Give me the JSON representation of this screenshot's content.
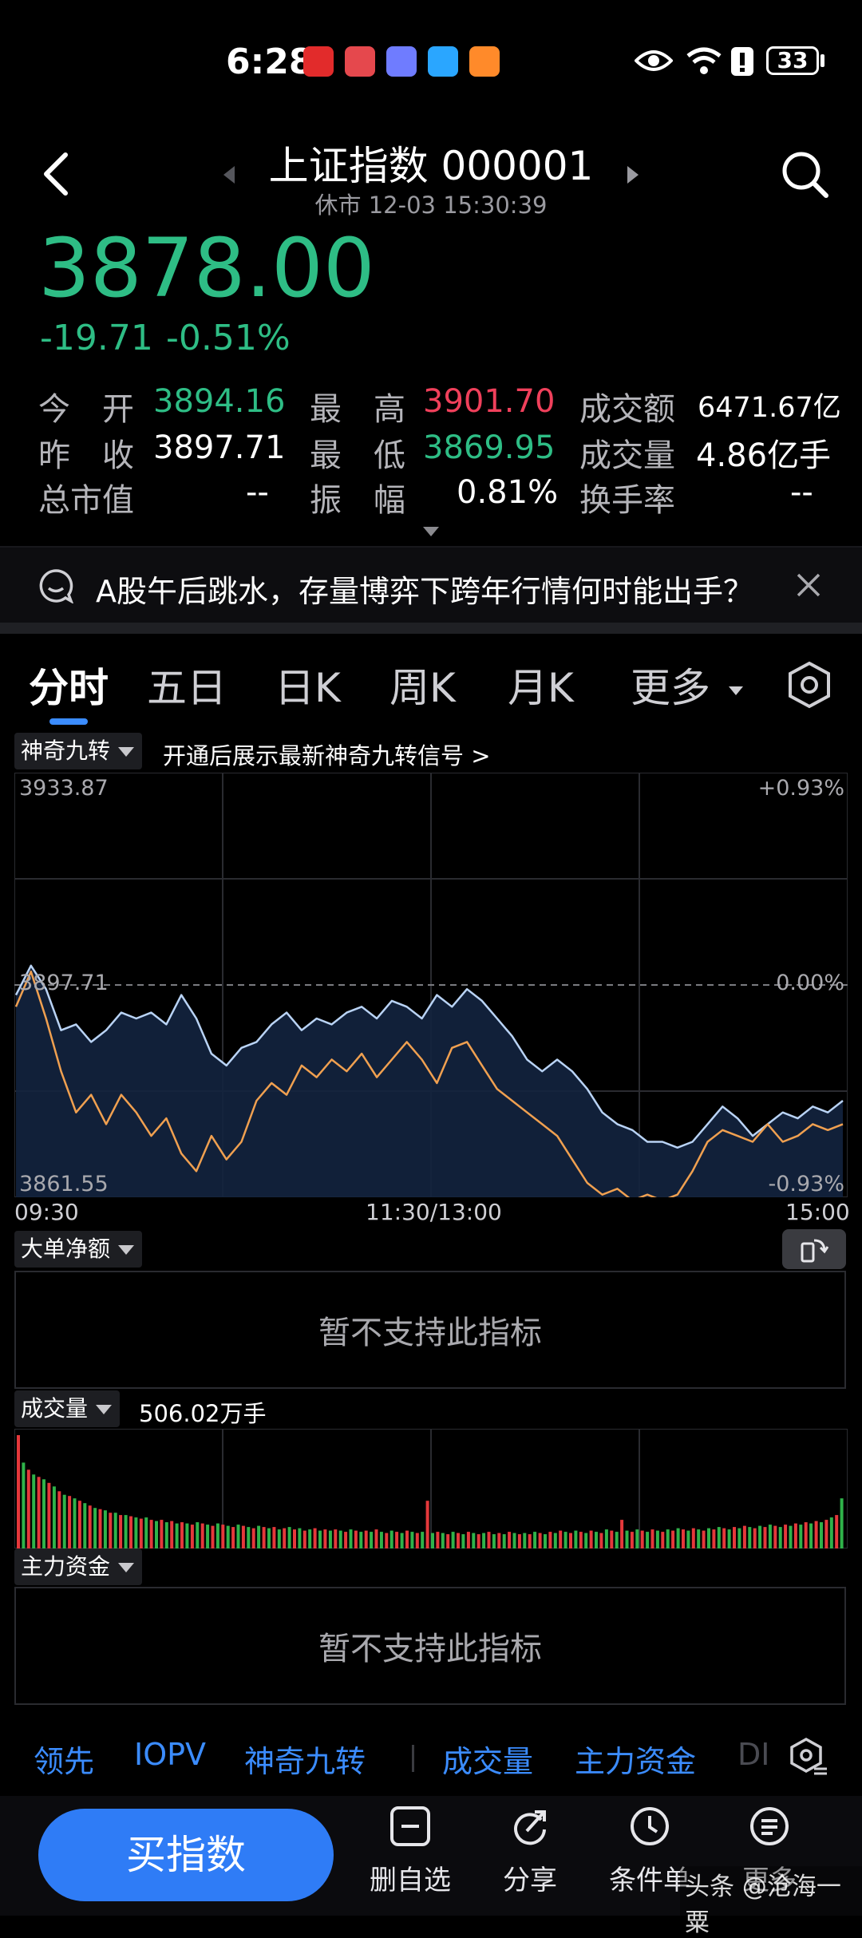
{
  "status_bar": {
    "time": "6:28",
    "battery": "33"
  },
  "header": {
    "title": "上证指数 000001",
    "subtitle": "休市 12-03 15:30:39"
  },
  "quote": {
    "price": "3878.00",
    "change": "-19.71",
    "change_pct": "-0.51%"
  },
  "stats": {
    "open_label": "今　开",
    "open": "3894.16",
    "high_label": "最　高",
    "high": "3901.70",
    "turnover_label": "成交额",
    "turnover": "6471.67亿",
    "prev_close_label": "昨　收",
    "prev_close": "3897.71",
    "low_label": "最　低",
    "low": "3869.95",
    "volume_label": "成交量",
    "volume": "4.86亿手",
    "mcap_label": "总市值",
    "mcap": "--",
    "amplitude_label": "振　幅",
    "amplitude": "0.81%",
    "turnover_rate_label": "换手率",
    "turnover_rate": "--"
  },
  "news": {
    "text": "A股午后跳水，存量博弈下跨年行情何时能出手？"
  },
  "tabs": [
    "分时",
    "五日",
    "日K",
    "周K",
    "月K",
    "更多"
  ],
  "indicator": {
    "name": "神奇九转",
    "hint": "开通后展示最新神奇九转信号 >"
  },
  "chart_data": {
    "type": "line",
    "y_labels": {
      "top": "3933.87",
      "mid": "3897.71",
      "bottom": "3861.55"
    },
    "pct_labels": {
      "top": "+0.93%",
      "mid": "0.00%",
      "bottom": "-0.93%"
    },
    "x_labels": [
      "09:30",
      "11:30/13:00",
      "15:00"
    ],
    "ylim": [
      3861.55,
      3933.87
    ],
    "series": [
      {
        "name": "index",
        "color": "#b9d3f5",
        "values": [
          3896,
          3901,
          3897,
          3890,
          3891,
          3888,
          3890,
          3893,
          3892,
          3893,
          3891,
          3896,
          3892,
          3886,
          3884,
          3887,
          3888,
          3891,
          3893,
          3890,
          3892,
          3891,
          3893,
          3894,
          3892,
          3895,
          3894,
          3892,
          3896,
          3894,
          3897,
          3895,
          3892,
          3889,
          3885,
          3883,
          3885,
          3883,
          3880,
          3876,
          3874,
          3873,
          3871,
          3871,
          3870,
          3871,
          3874,
          3877,
          3875,
          3872,
          3874,
          3876,
          3875,
          3877,
          3876,
          3878
        ]
      },
      {
        "name": "average",
        "color": "#f0a050",
        "values": [
          3894,
          3900,
          3892,
          3883,
          3876,
          3879,
          3874,
          3879,
          3876,
          3872,
          3875,
          3869,
          3866,
          3872,
          3868,
          3871,
          3878,
          3881,
          3879,
          3884,
          3882,
          3885,
          3883,
          3886,
          3882,
          3885,
          3888,
          3885,
          3881,
          3887,
          3888,
          3884,
          3880,
          3878,
          3876,
          3874,
          3872,
          3868,
          3864,
          3862,
          3863,
          3861,
          3862,
          3861,
          3862,
          3866,
          3871,
          3873,
          3872,
          3871,
          3874,
          3871,
          3872,
          3874,
          3873,
          3874
        ]
      }
    ]
  },
  "big_order": {
    "label": "大单净额",
    "empty_text": "暂不支持此指标"
  },
  "volume_panel": {
    "label": "成交量",
    "value": "506.02万手",
    "bars": [
      95,
      72,
      66,
      62,
      60,
      58,
      55,
      52,
      48,
      45,
      44,
      42,
      40,
      38,
      36,
      34,
      33,
      32,
      30,
      30,
      28,
      28,
      27,
      26,
      25,
      26,
      24,
      23,
      24,
      22,
      23,
      21,
      22,
      21,
      20,
      22,
      21,
      20,
      19,
      21,
      20,
      19,
      18,
      20,
      19,
      18,
      17,
      19,
      18,
      17,
      18,
      16,
      17,
      18,
      16,
      17,
      15,
      16,
      17,
      15,
      16,
      15,
      16,
      15,
      14,
      16,
      15,
      14,
      15,
      14,
      16,
      14,
      13,
      15,
      14,
      13,
      15,
      14,
      13,
      14,
      40,
      13,
      14,
      13,
      12,
      14,
      13,
      12,
      14,
      13,
      12,
      13,
      14,
      12,
      13,
      12,
      14,
      13,
      12,
      13,
      12,
      14,
      13,
      12,
      14,
      13,
      15,
      14,
      13,
      15,
      14,
      13,
      15,
      14,
      13,
      16,
      15,
      14,
      24,
      15,
      14,
      16,
      15,
      14,
      16,
      15,
      14,
      16,
      15,
      17,
      16,
      15,
      17,
      16,
      15,
      17,
      16,
      18,
      17,
      16,
      18,
      17,
      19,
      18,
      17,
      19,
      18,
      20,
      19,
      18,
      20,
      19,
      21,
      20,
      22,
      21,
      23,
      22,
      24,
      26,
      28,
      42
    ],
    "bar_colors": [
      "red",
      "green"
    ]
  },
  "main_fund": {
    "label": "主力资金",
    "empty_text": "暂不支持此指标"
  },
  "bottom_tabs": [
    "领先",
    "IOPV",
    "神奇九转",
    "成交量",
    "主力资金"
  ],
  "bottom_nav": {
    "buy_label": "买指数",
    "items": [
      "删自选",
      "分享",
      "条件单",
      "更多"
    ],
    "watermark": "头条 @沧海一粟"
  }
}
